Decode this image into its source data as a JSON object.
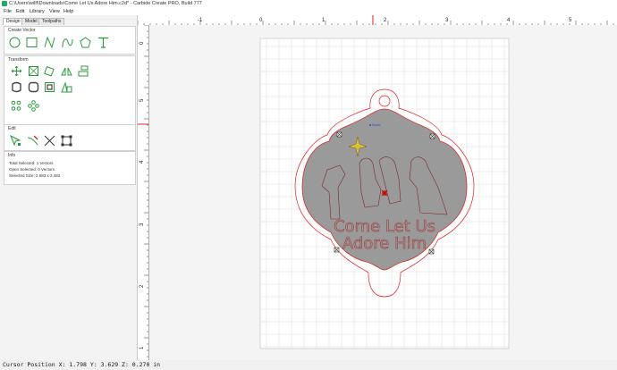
{
  "window": {
    "title": "C:\\Users\\willf\\Downloads\\Come Let Us Adore Him.c2d* - Carbide Create PRO, Build 777"
  },
  "menu": {
    "file": "File",
    "edit": "Edit",
    "library": "Library",
    "view": "View",
    "help": "Help"
  },
  "left_panel": {
    "tabs": {
      "design": "Design",
      "model": "Model",
      "toolpaths": "Toolpaths"
    },
    "create_vector": {
      "title": "Create Vector",
      "tools": [
        "circle-icon",
        "rectangle-icon",
        "polyline-icon",
        "curve-icon",
        "polygon-icon",
        "text-icon"
      ]
    },
    "transform": {
      "title": "Transform"
    },
    "edit": {
      "title": "Edit"
    },
    "info": {
      "title": "Info",
      "total_selected": "Total Selected:  1 Vectors",
      "open_selected": "Open Selected:  0 Vectors",
      "selected_size": "Selected Size:  2.683 x 2.483"
    }
  },
  "ruler": {
    "top_labels": [
      "-1",
      "0",
      "1",
      "2",
      "3",
      "4",
      "5"
    ],
    "left_labels": [
      "5",
      "4",
      "3",
      "2",
      "1",
      "0"
    ]
  },
  "canvas": {
    "text_line1": "Come Let Us",
    "text_line2": "Adore Him",
    "node_label": "Node",
    "colors": {
      "selection": "#e02020",
      "shape_fill": "#9a9a9a",
      "sheet": "#ffffff",
      "grid": "#dcdcdc",
      "star": "#d8c040"
    }
  },
  "status": {
    "cursor": "Cursor Position X: 1.798 Y: 3.629 Z: 0.270 in"
  }
}
